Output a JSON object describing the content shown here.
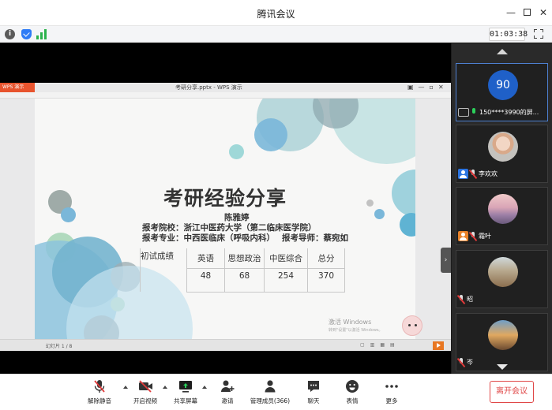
{
  "window": {
    "title": "腾讯会议",
    "controls": {
      "minimize": "—",
      "close": "✕"
    }
  },
  "infobar": {
    "timer": "01:03:38",
    "icons": [
      "info-icon",
      "shield-icon",
      "signal-icon",
      "fullscreen-icon"
    ]
  },
  "shared_screen": {
    "app_tab": "WPS 演示",
    "file_title": "考研分享.pptx - WPS 演示",
    "slide": {
      "title": "考研经验分享",
      "presenter": "陈雅婷",
      "school_line": "报考院校：浙江中医药大学（第二临床医学院）",
      "major_line": "报考专业：中西医临床（呼吸内科）",
      "advisor_line": "报考导师：蔡宛如",
      "table": {
        "row_label": "初试成绩",
        "headers": [
          "英语",
          "思想政治",
          "中医综合",
          "总分"
        ],
        "values": [
          "48",
          "68",
          "254",
          "370"
        ]
      },
      "watermark": "激活 Windows",
      "watermark_sub": "转到\"设置\"以激活 Windows。"
    },
    "status": {
      "page_indicator": "幻灯片 1 / 8"
    }
  },
  "participants": [
    {
      "avatar_text": "90",
      "name": "150****3990的屏...",
      "tag": "share",
      "mic": "on"
    },
    {
      "name": "李欢欢",
      "tag": "blue",
      "mic": "muted"
    },
    {
      "name": "霜叶",
      "tag": "orange",
      "mic": "muted"
    },
    {
      "name": "昭",
      "tag": "",
      "mic": "muted"
    },
    {
      "name": "岑",
      "tag": "",
      "mic": "muted"
    }
  ],
  "toolbar": {
    "mute_label": "解除静音",
    "video_label": "开启视频",
    "share_label": "共享屏幕",
    "invite_label": "邀请",
    "members_label": "管理成员(366)",
    "chat_label": "聊天",
    "emoji_label": "表情",
    "more_label": "更多",
    "leave_label": "离开会议"
  },
  "colors": {
    "accent_blue": "#1f60c8",
    "leave_red": "#e04848",
    "mic_on_green": "#2bd05a",
    "wps_orange": "#e8542e"
  }
}
